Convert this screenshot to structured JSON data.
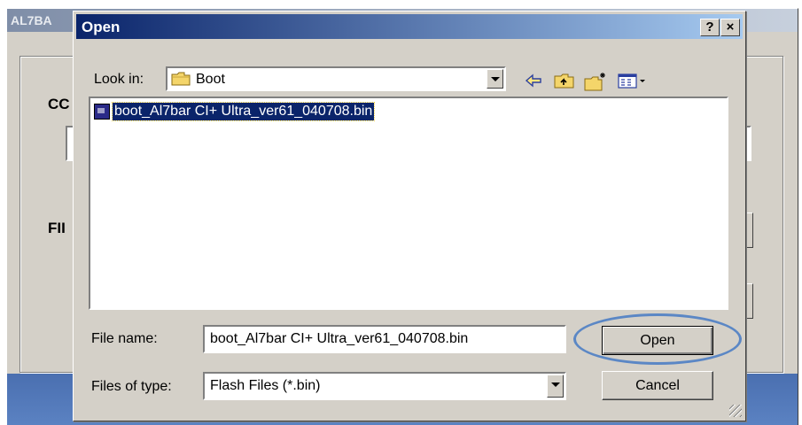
{
  "background_window": {
    "title": "AL7BA",
    "label_1": "CC",
    "label_2": "FII"
  },
  "dialog": {
    "title": "Open",
    "help_label": "?",
    "close_label": "×"
  },
  "look_in": {
    "label": "Look in:",
    "value": "Boot"
  },
  "toolbar": {
    "icons": [
      "back-icon",
      "up-folder-icon",
      "new-folder-icon",
      "view-menu-icon"
    ]
  },
  "files": [
    {
      "name": "boot_Al7bar CI+ Ultra_ver61_040708.bin",
      "selected": true
    }
  ],
  "file_name": {
    "label": "File name:",
    "value": "boot_Al7bar CI+ Ultra_ver61_040708.bin"
  },
  "file_type": {
    "label": "Files of type:",
    "value": "Flash Files (*.bin)"
  },
  "buttons": {
    "open": "Open",
    "cancel": "Cancel"
  },
  "colors": {
    "titlebar_start": "#0a246a",
    "titlebar_end": "#a6caf0",
    "selection": "#0a246a",
    "highlight_ellipse": "#5b87c5",
    "face": "#d4d0c8"
  }
}
